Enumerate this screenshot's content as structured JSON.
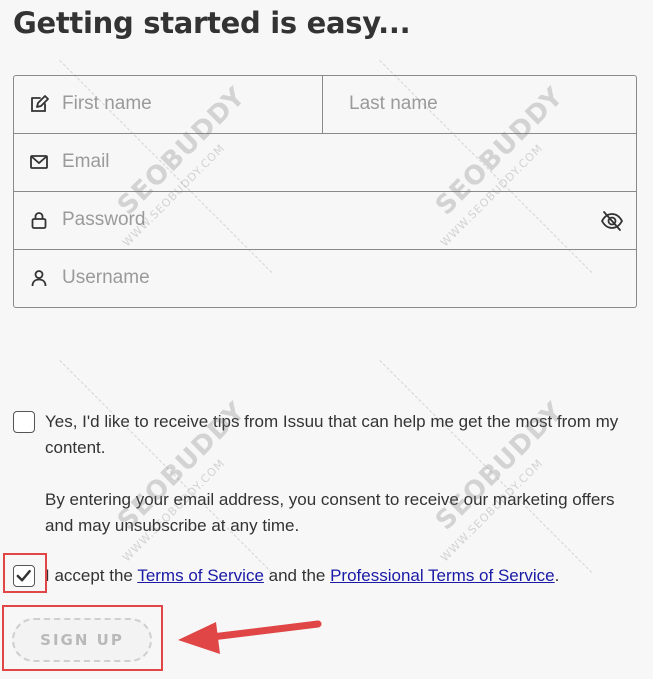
{
  "heading": "Getting started is easy...",
  "form": {
    "first_name_placeholder": "First name",
    "last_name_placeholder": "Last name",
    "email_placeholder": "Email",
    "password_placeholder": "Password",
    "username_placeholder": "Username",
    "icons": {
      "first_name": "edit-pencil-icon",
      "email": "envelope-icon",
      "password": "lock-icon",
      "username": "user-icon",
      "password_toggle": "eye-slash-icon"
    }
  },
  "tips_option": {
    "checked": false,
    "text": "Yes, I'd like to receive tips from Issuu that can help me get the most from my content.",
    "consent": "By entering your email address, you consent to receive our marketing offers and may unsubscribe at any time."
  },
  "terms_option": {
    "checked": true,
    "prefix": "I accept the ",
    "terms_link": "Terms of Service",
    "middle": " and the ",
    "pro_terms_link": "Professional Terms of Service",
    "suffix": "."
  },
  "signup_button": "SIGN UP",
  "watermark": {
    "brand": "SEOBUDDY",
    "url": "WWW.SEOBUDDY.COM"
  },
  "colors": {
    "link": "#1a1aa6",
    "annotation_red": "#e04646",
    "button_text_disabled": "#b9b9b9"
  }
}
